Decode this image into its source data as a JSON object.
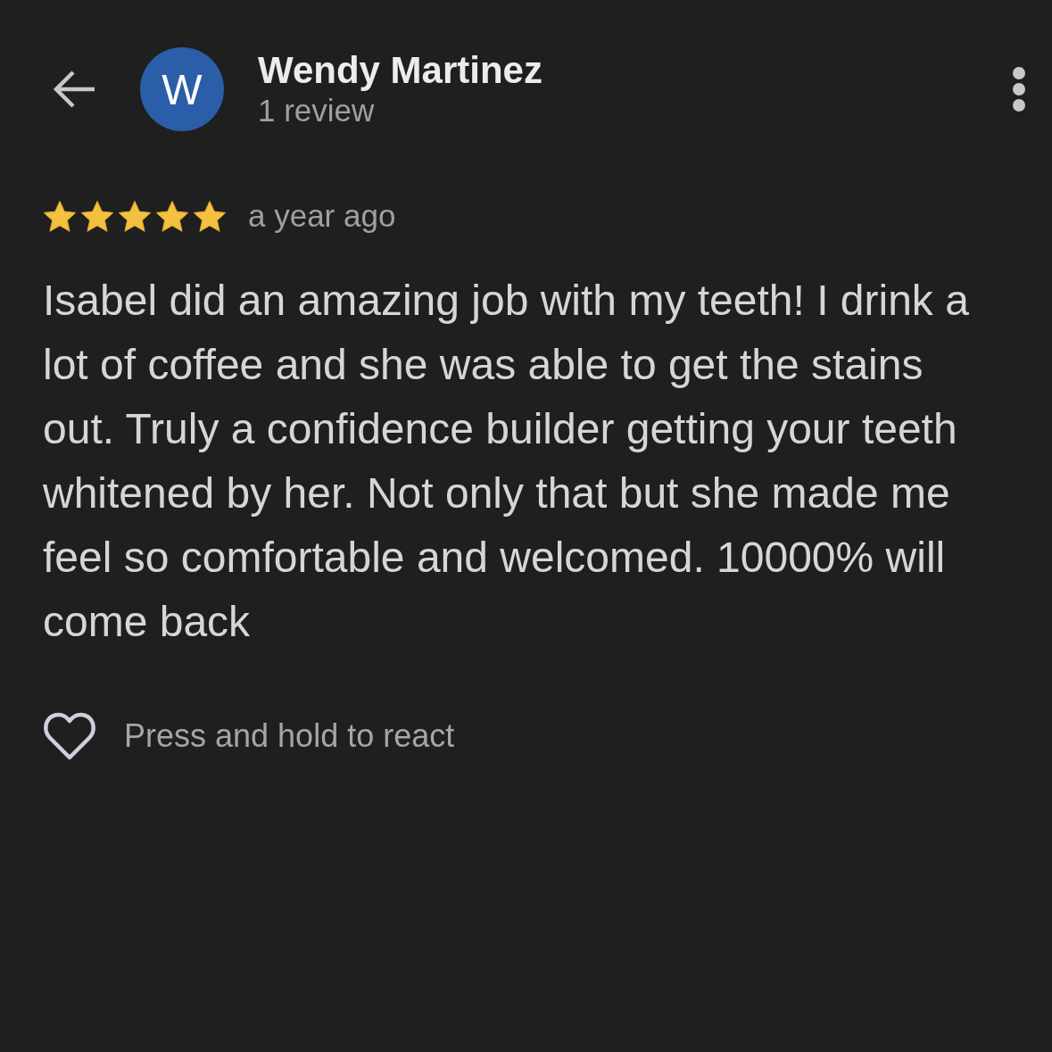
{
  "reviewer": {
    "avatar_letter": "W",
    "name": "Wendy Martinez",
    "review_count": "1 review"
  },
  "review": {
    "stars": 5,
    "time": "a year ago",
    "text": "Isabel did an amazing job with my teeth! I drink a lot of coffee and she was able to get the stains out. Truly a confidence builder getting your teeth whitened by her. Not only that but she made me feel so comfortable and welcomed. 10000% will come back"
  },
  "reaction": {
    "hint": "Press and hold to react"
  }
}
